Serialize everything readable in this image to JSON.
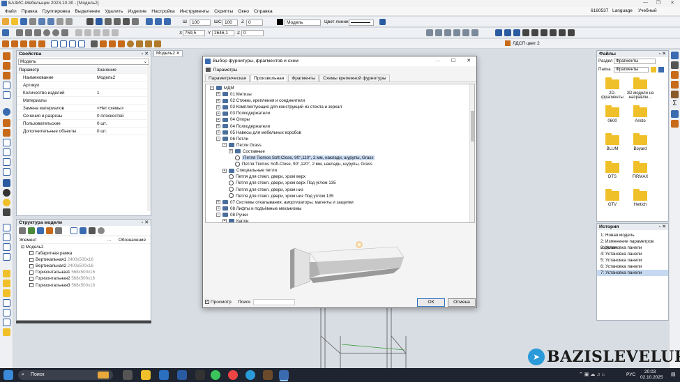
{
  "app": {
    "title": "БАЗИС-Мебельщик 2023.10.30 - [Модель2]"
  },
  "menu": [
    "Файл",
    "Правка",
    "Группировка",
    "Выделение",
    "Удалить",
    "Изделие",
    "Настройка",
    "Инструменты",
    "Скрипты",
    "Окно",
    "Справка"
  ],
  "menu_right": {
    "number": "6160537",
    "language": "Language",
    "mode": "Учебный"
  },
  "toolbar": {
    "thickness_label": "Ш",
    "thickness": "100",
    "width_label": "ШС",
    "width": "100",
    "z_label": "Z",
    "z": "0",
    "x_label": "X",
    "x": "759,5",
    "y_label": "Y",
    "y": "2646,1",
    "zz_label": "Z",
    "zz": "0",
    "layer": "Модель",
    "line_color_label": "Цвет линии",
    "material": "ЛДСП цвет 2"
  },
  "properties": {
    "title": "Свойства",
    "object": "Модель",
    "col_param": "Параметр",
    "col_value": "Значение",
    "rows": [
      {
        "k": "Наименование",
        "v": "Модель2"
      },
      {
        "k": "Артикул",
        "v": ""
      },
      {
        "k": "Количество изделий",
        "v": "1"
      },
      {
        "k": "Материалы",
        "v": ""
      },
      {
        "k": "Замена материалов",
        "v": "<Нет схемы>"
      },
      {
        "k": "Сечения и разрезы",
        "v": "0 плоскостей"
      },
      {
        "k": "Пользовательские",
        "v": "0 шт."
      },
      {
        "k": "Дополнительные объекты",
        "v": "0 шт."
      }
    ]
  },
  "structure": {
    "title": "Структура модели",
    "col_elem": "Элемент",
    "col_dots": "...",
    "col_desig": "Обозначение",
    "root": "Модель2",
    "items": [
      {
        "name": "Габаритная рамка",
        "size": ""
      },
      {
        "name": "Вертикальная1",
        "size": "2400x500x16"
      },
      {
        "name": "Вертикальная2",
        "size": "2400x500x16"
      },
      {
        "name": "Горизонтальная1",
        "size": "568x500x16"
      },
      {
        "name": "Горизонтальная2",
        "size": "568x500x16"
      },
      {
        "name": "Горизонтальная3",
        "size": "568x500x16"
      }
    ]
  },
  "doc_tab": "Модель2",
  "dialog": {
    "title": "Выбор фурнитуры, фрагментов и схем",
    "params": "Параметры",
    "tabs": [
      "Параметрическая",
      "Произвольная",
      "Фрагменты",
      "Схемы крепежной фурнитуры"
    ],
    "tree": [
      {
        "lvl": 0,
        "t": "МДМ",
        "type": "folder",
        "exp": "-"
      },
      {
        "lvl": 1,
        "t": "01 Метизы",
        "type": "folder",
        "exp": "+"
      },
      {
        "lvl": 1,
        "t": "02 Стяжки, крепления и соединители",
        "type": "folder",
        "exp": "+"
      },
      {
        "lvl": 1,
        "t": "03 Комплектующие для конструкций из стекла и зеркал",
        "type": "folder",
        "exp": "+"
      },
      {
        "lvl": 1,
        "t": "03 Полкодержатели",
        "type": "folder",
        "exp": "+"
      },
      {
        "lvl": 1,
        "t": "04 Опоры",
        "type": "folder",
        "exp": "+"
      },
      {
        "lvl": 1,
        "t": "04 Полкодержатели",
        "type": "folder",
        "exp": "+"
      },
      {
        "lvl": 1,
        "t": "05 Навесы для мебельных коробов",
        "type": "folder",
        "exp": "+"
      },
      {
        "lvl": 1,
        "t": "06 Петли",
        "type": "folder",
        "exp": "-"
      },
      {
        "lvl": 2,
        "t": "Петли Grass",
        "type": "folder",
        "exp": "-"
      },
      {
        "lvl": 3,
        "t": "Составные",
        "type": "folder",
        "exp": "+"
      },
      {
        "lvl": 3,
        "t": "Петля Tiomos Soft-Close, 90°,110°, 2 мм, накладн, шурупы, Grass",
        "type": "hinge",
        "exp": "",
        "sel": true
      },
      {
        "lvl": 3,
        "t": "Петля Tiomos Soft-Close, 90°,120°, 2 мм, накладн, шурупы, Grass",
        "type": "hinge",
        "exp": ""
      },
      {
        "lvl": 2,
        "t": "Специальные петли",
        "type": "folder",
        "exp": "+"
      },
      {
        "lvl": 2,
        "t": "Петля для стекл. двери, хром верх",
        "type": "hinge",
        "exp": ""
      },
      {
        "lvl": 2,
        "t": "Петля для стекл. двери, хром верх Под углом 135",
        "type": "hinge",
        "exp": ""
      },
      {
        "lvl": 2,
        "t": "Петля для стекл. двери, хром низ",
        "type": "hinge",
        "exp": ""
      },
      {
        "lvl": 2,
        "t": "Петля для стекл. двери, хром низ Под углом 135",
        "type": "hinge",
        "exp": ""
      },
      {
        "lvl": 1,
        "t": "07 Системы откалывания, амортизаторы, магниты и защелки",
        "type": "folder",
        "exp": "+"
      },
      {
        "lvl": 1,
        "t": "08 Лифты и подъёмные механизмы",
        "type": "folder",
        "exp": "+"
      },
      {
        "lvl": 1,
        "t": "08 Ручки",
        "type": "folder",
        "exp": "-"
      },
      {
        "lvl": 2,
        "t": "Капли",
        "type": "folder",
        "exp": "+"
      }
    ],
    "preview_label": "Просмотр",
    "search_label": "Поиск",
    "ok": "ОК",
    "cancel": "Отмена"
  },
  "files": {
    "title": "Файлы",
    "section_label": "Раздел",
    "section": "Фрагменты",
    "folder_label": "Папка",
    "folder": "Фрагменты",
    "items": [
      "2D-фрагменты",
      "3D модели на направлю...",
      "0600",
      "Aristo",
      "BLUM",
      "Boyard",
      "DTS",
      "FIRMAX",
      "GTV",
      "Hettich"
    ]
  },
  "history": {
    "title": "История",
    "items": [
      "1: Новая модель",
      "2: Изменение параметров изделия",
      "3: Установка панели",
      "4: Установка панели",
      "5: Установка панели",
      "6: Установка панели",
      "7: Установка панели"
    ]
  },
  "watermark": "BAZISLEVELUP",
  "taskbar": {
    "search": "Поиск",
    "lang": "РУС",
    "time": "20:03",
    "date": "02.10.2025"
  }
}
